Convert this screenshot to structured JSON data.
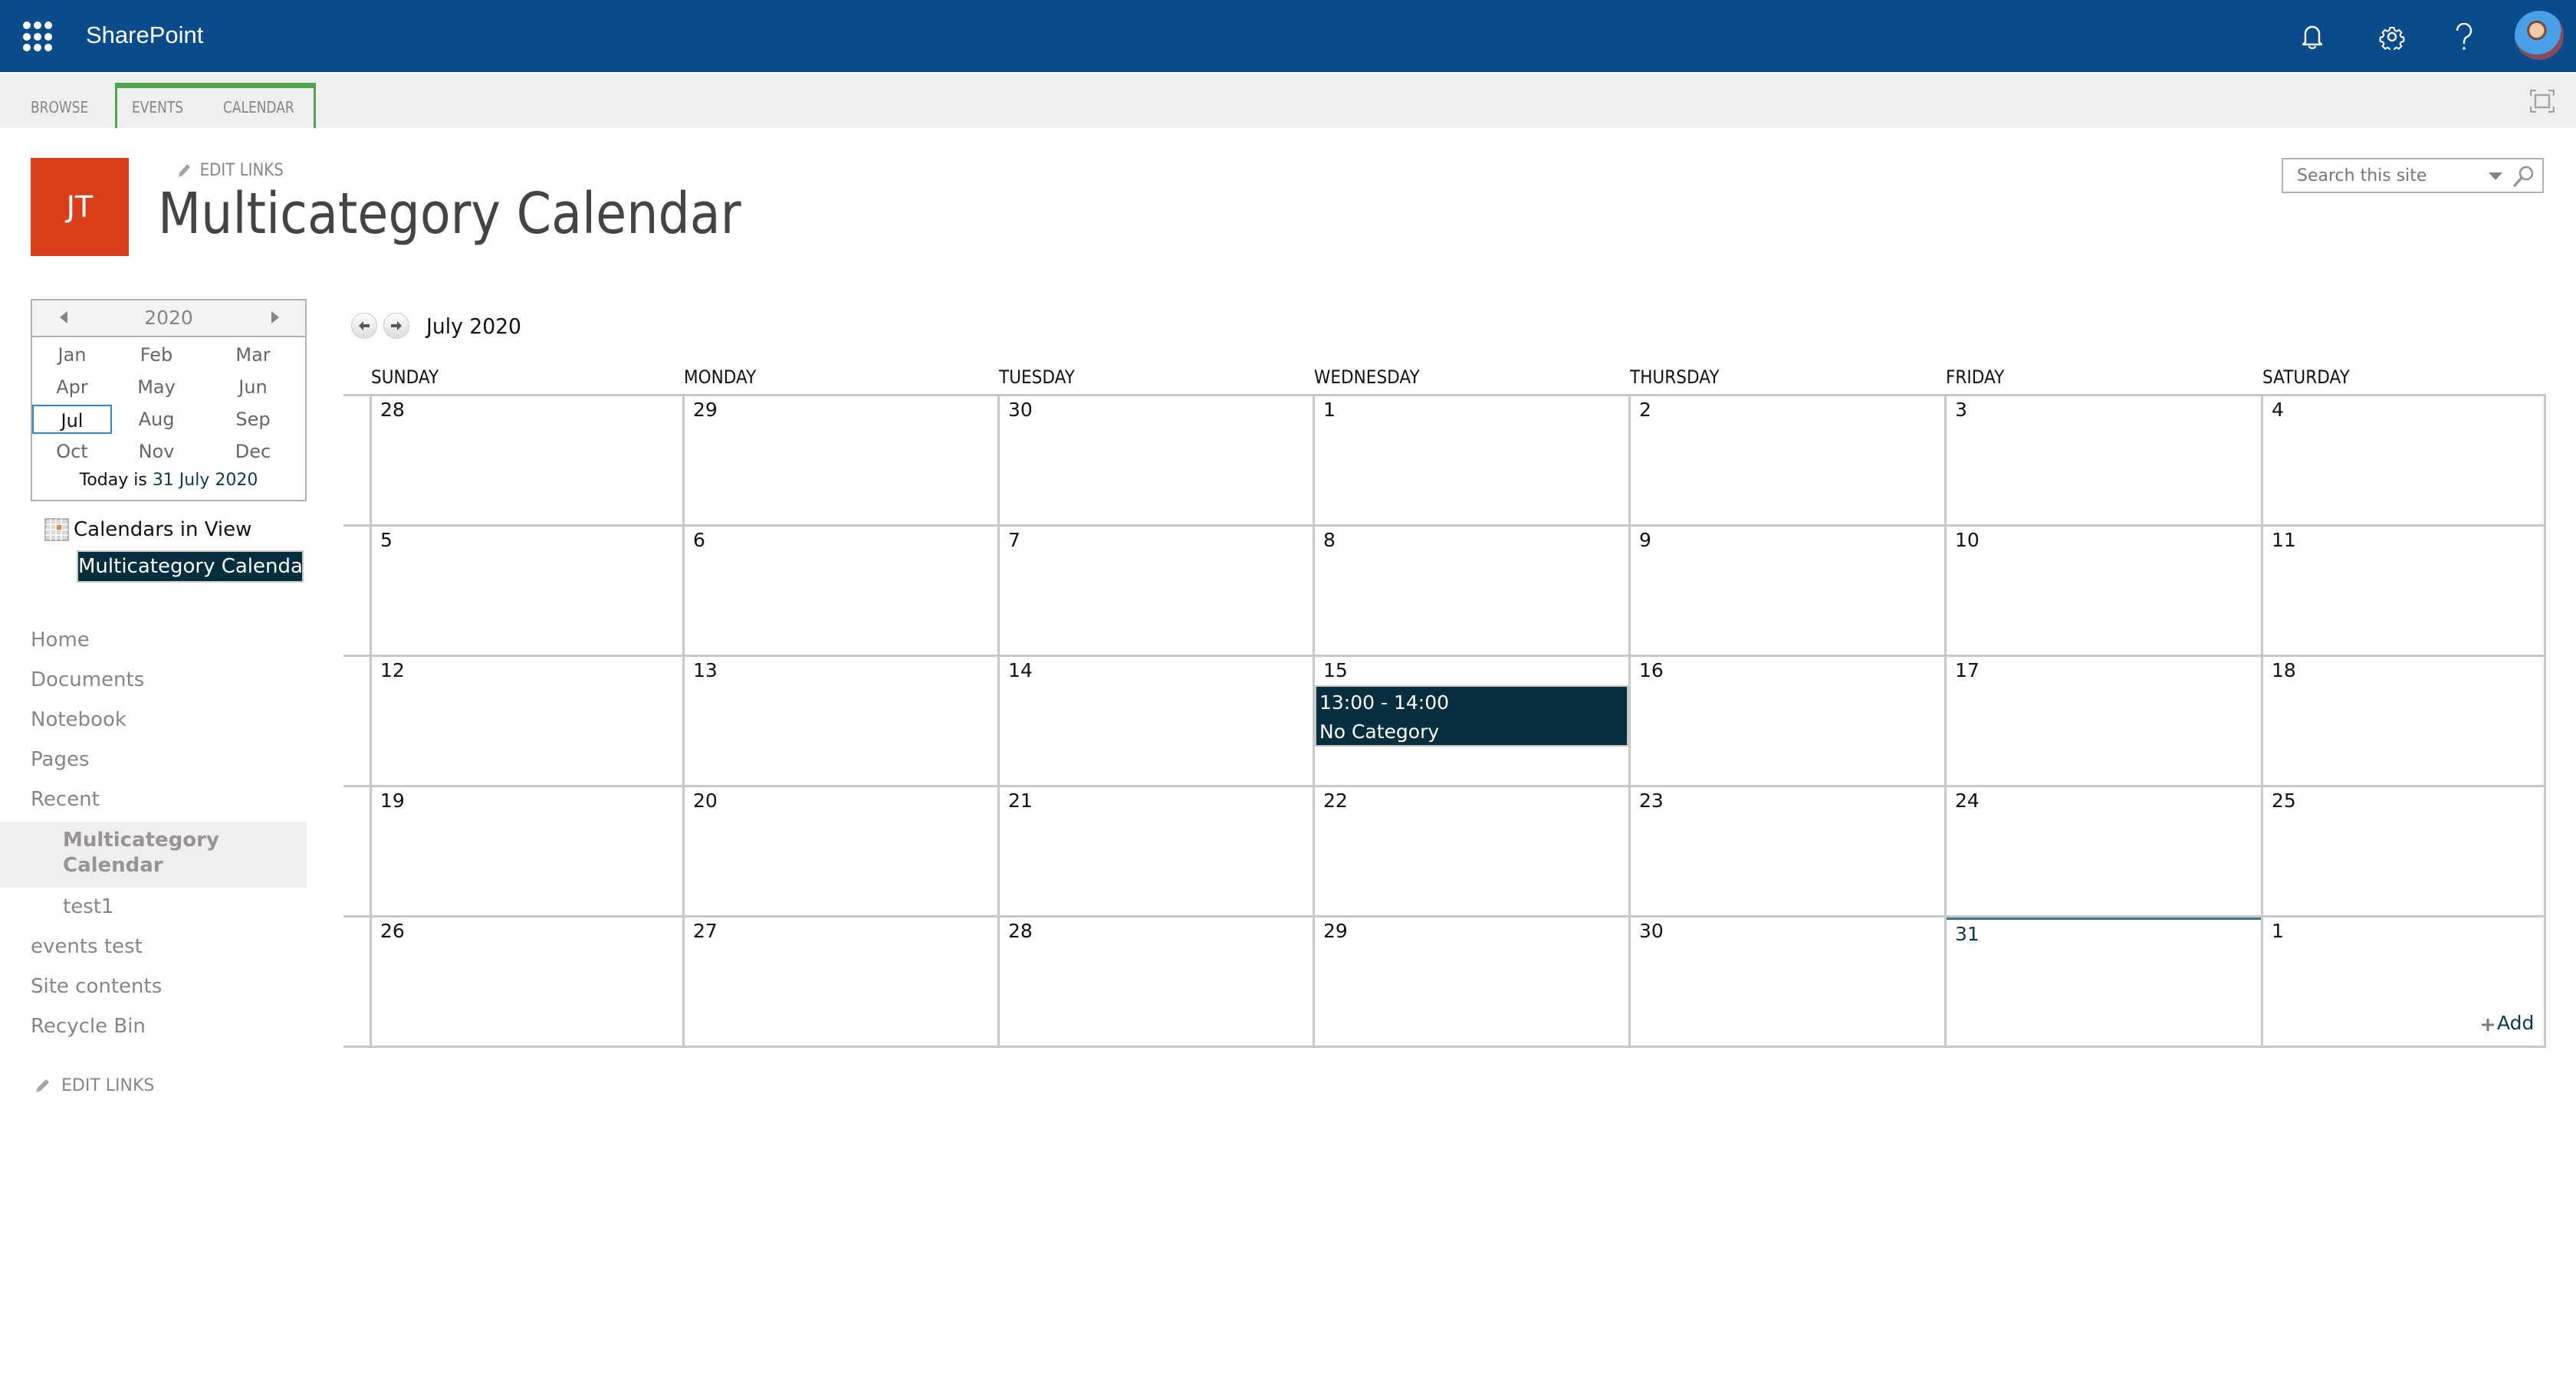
{
  "suite_bar": {
    "app_name": "SharePoint",
    "icons": [
      "app-launcher-icon",
      "bell-icon",
      "gear-icon",
      "help-icon",
      "avatar"
    ],
    "background": "#0a4b8a"
  },
  "ribbon": {
    "tabs": [
      {
        "label": "BROWSE"
      },
      {
        "label": "EVENTS"
      },
      {
        "label": "CALENDAR"
      }
    ],
    "group_accent": "#4ea54e",
    "focus_icon": "focus-mode-icon"
  },
  "site": {
    "logo_initials": "JT",
    "logo_color": "#d93f1a",
    "edit_links": "EDIT LINKS",
    "page_title": "Multicategory Calendar"
  },
  "search": {
    "placeholder": "Search this site"
  },
  "date_picker": {
    "year": "2020",
    "months": [
      "Jan",
      "Feb",
      "Mar",
      "Apr",
      "May",
      "Jun",
      "Jul",
      "Aug",
      "Sep",
      "Oct",
      "Nov",
      "Dec"
    ],
    "selected_month": "Jul",
    "today_prefix": "Today is ",
    "today_date": "31 July 2020"
  },
  "calendars_in_view": {
    "label": "Calendars in View",
    "items": [
      "Multicategory Calendar"
    ]
  },
  "left_nav": {
    "items": [
      {
        "label": "Home"
      },
      {
        "label": "Documents"
      },
      {
        "label": "Notebook"
      },
      {
        "label": "Pages"
      },
      {
        "label": "Recent"
      }
    ],
    "recent": [
      {
        "label": "Multicategory Calendar",
        "selected": true
      },
      {
        "label": "test1"
      }
    ],
    "after": [
      {
        "label": "events test"
      },
      {
        "label": "Site contents"
      },
      {
        "label": "Recycle Bin"
      }
    ],
    "edit_links": "EDIT LINKS"
  },
  "calendar": {
    "month_label": "July 2020",
    "day_headers": [
      "SUNDAY",
      "MONDAY",
      "TUESDAY",
      "WEDNESDAY",
      "THURSDAY",
      "FRIDAY",
      "SATURDAY"
    ],
    "weeks": [
      [
        "28",
        "29",
        "30",
        "1",
        "2",
        "3",
        "4"
      ],
      [
        "5",
        "6",
        "7",
        "8",
        "9",
        "10",
        "11"
      ],
      [
        "12",
        "13",
        "14",
        "15",
        "16",
        "17",
        "18"
      ],
      [
        "19",
        "20",
        "21",
        "22",
        "23",
        "24",
        "25"
      ],
      [
        "26",
        "27",
        "28",
        "29",
        "30",
        "31",
        "1"
      ]
    ],
    "today": {
      "week": 4,
      "day": 5
    },
    "events": [
      {
        "week": 2,
        "day": 3,
        "time": "13:00 - 14:00",
        "title": "No Category",
        "color": "#062f3d"
      }
    ],
    "add_label": "Add"
  }
}
